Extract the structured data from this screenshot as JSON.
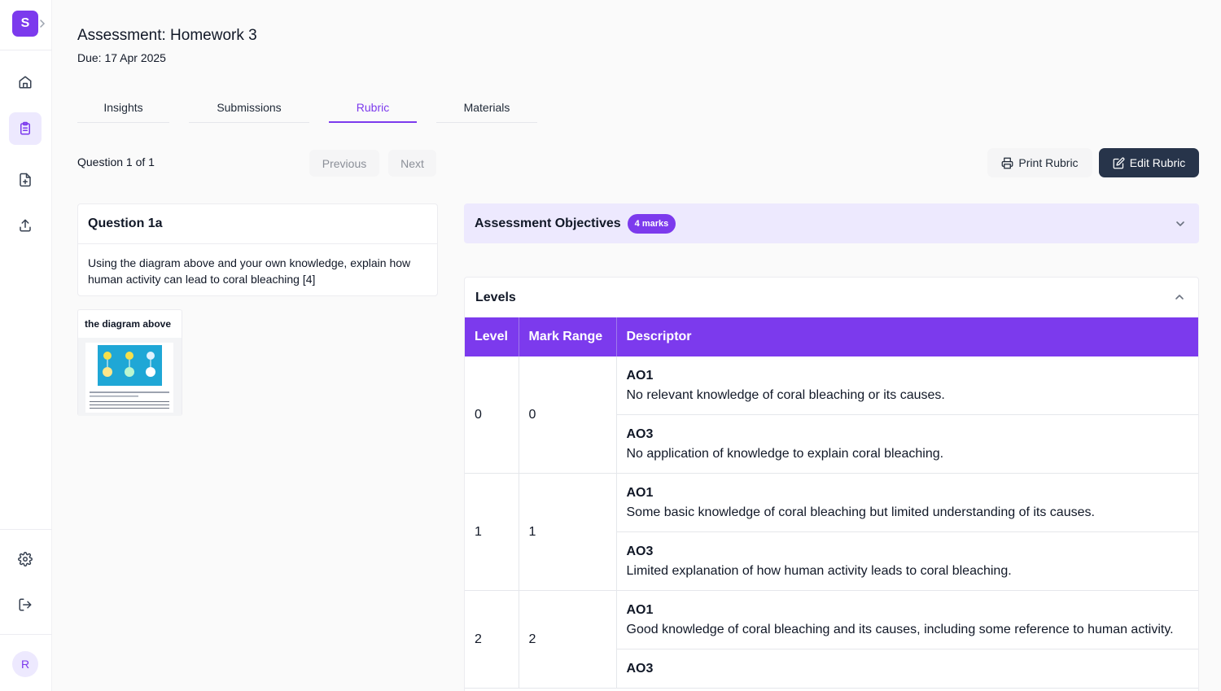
{
  "app": {
    "logo_letter": "S",
    "user_initial": "R"
  },
  "colors": {
    "accent": "#7c3aed",
    "accent_light": "#ede9fe",
    "dark_button": "#27344a"
  },
  "sidebar": {
    "items": [
      {
        "icon": "home-icon"
      },
      {
        "icon": "clipboard-icon",
        "active": true
      },
      {
        "icon": "file-plus-icon"
      },
      {
        "icon": "upload-icon"
      },
      {
        "icon": "gear-icon"
      },
      {
        "icon": "logout-icon"
      }
    ]
  },
  "header": {
    "title": "Assessment: Homework 3",
    "due": "Due: 17 Apr 2025"
  },
  "tabs": [
    {
      "label": "Insights"
    },
    {
      "label": "Submissions"
    },
    {
      "label": "Rubric",
      "active": true
    },
    {
      "label": "Materials"
    }
  ],
  "question_nav": {
    "count": "Question 1 of 1",
    "previous": "Previous",
    "next": "Next",
    "print": "Print Rubric",
    "edit": "Edit Rubric"
  },
  "question": {
    "title": "Question 1a",
    "text": "Using the diagram above and your own knowledge, explain how human activity can lead to coral bleaching [4]",
    "attachment_label": "the diagram above"
  },
  "objectives": {
    "title": "Assessment Objectives",
    "badge": "4 marks"
  },
  "levels": {
    "title": "Levels",
    "headers": [
      "Level",
      "Mark Range",
      "Descriptor"
    ],
    "rows": [
      {
        "level": "0",
        "range": "0",
        "descriptors": [
          {
            "code": "AO1",
            "text": "No relevant knowledge of coral bleaching or its causes."
          },
          {
            "code": "AO3",
            "text": "No application of knowledge to explain coral bleaching."
          }
        ]
      },
      {
        "level": "1",
        "range": "1",
        "descriptors": [
          {
            "code": "AO1",
            "text": "Some basic knowledge of coral bleaching but limited understanding of its causes."
          },
          {
            "code": "AO3",
            "text": "Limited explanation of how human activity leads to coral bleaching."
          }
        ]
      },
      {
        "level": "2",
        "range": "2",
        "descriptors": [
          {
            "code": "AO1",
            "text": "Good knowledge of coral bleaching and its causes, including some reference to human activity."
          },
          {
            "code": "AO3",
            "text": ""
          }
        ]
      }
    ]
  }
}
